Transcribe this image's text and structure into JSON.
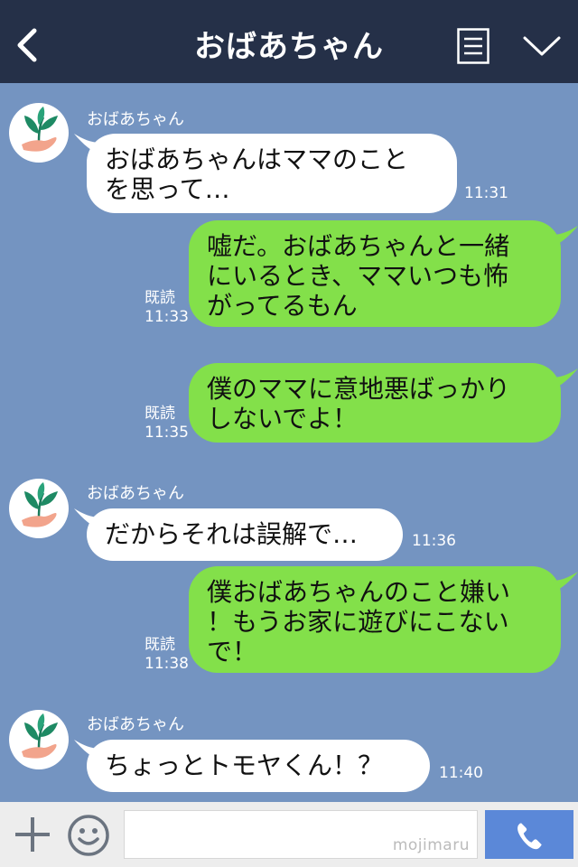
{
  "header": {
    "title": "おばあちゃん"
  },
  "messages": [
    {
      "type": "in",
      "sender": "おばあちゃん",
      "text": "おばあちゃんはママのこと\nを思って…",
      "time": "11:31"
    },
    {
      "type": "out",
      "status": "既読",
      "text": "嘘だ。おばあちゃんと一緒\nにいるとき、ママいつも怖\nがってるもん",
      "time": "11:33"
    },
    {
      "type": "out",
      "status": "既読",
      "text": "僕のママに意地悪ばっかり\nしないでよ！",
      "time": "11:35"
    },
    {
      "type": "in",
      "sender": "おばあちゃん",
      "text": "だからそれは誤解で…",
      "time": "11:36"
    },
    {
      "type": "out",
      "status": "既読",
      "text": "僕おばあちゃんのこと嫌い\n！もうお家に遊びにこない\nで！",
      "time": "11:38"
    },
    {
      "type": "in",
      "sender": "おばあちゃん",
      "text": "ちょっとトモヤくん！？",
      "time": "11:40"
    }
  ],
  "composer": {
    "watermark": "mojimaru"
  },
  "colors": {
    "header_bg": "#253048",
    "chat_bg": "#7494c1",
    "outgoing_bubble": "#83e04a",
    "incoming_bubble": "#ffffff",
    "call_button": "#5b88d8"
  },
  "icons": {
    "back": "chevron-left-icon",
    "menu": "menu-icon",
    "collapse": "chevron-down-icon",
    "add": "plus-icon",
    "emoji": "smiley-icon",
    "call": "phone-icon",
    "avatar": "plant-hand-icon"
  }
}
